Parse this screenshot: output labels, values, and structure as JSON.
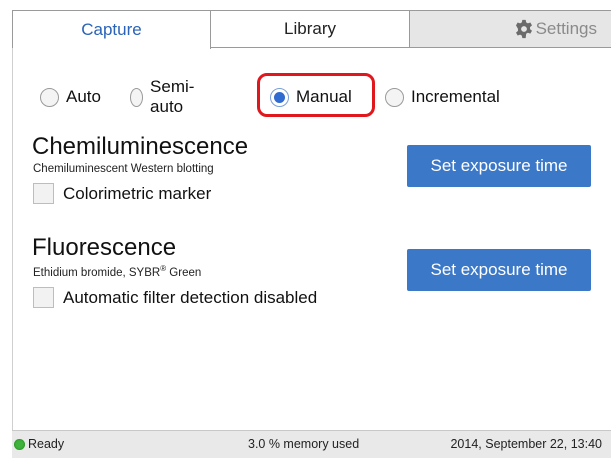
{
  "tabs": {
    "capture": "Capture",
    "library": "Library",
    "settings": "Settings"
  },
  "mode": {
    "options": [
      "Auto",
      "Semi-auto",
      "Manual",
      "Incremental"
    ],
    "selected": "Manual"
  },
  "chemi": {
    "title": "Chemiluminescence",
    "subtitle": "Chemiluminescent Western blotting",
    "checkbox_label": "Colorimetric marker",
    "button": "Set exposure time"
  },
  "fluor": {
    "title": "Fluorescence",
    "subtitle_pre": "Ethidium bromide, SYBR",
    "subtitle_reg": "®",
    "subtitle_post": " Green",
    "checkbox_label": "Automatic filter detection disabled",
    "button": "Set exposure time"
  },
  "status": {
    "ready": "Ready",
    "memory": "3.0 % memory used",
    "datetime": "2014, September 22, 13:40"
  },
  "colors": {
    "accent": "#3b78c8",
    "highlight": "#e0171d",
    "ready_led": "#3fb33b"
  },
  "icons": {
    "settings": "gear-icon",
    "ready": "status-led-icon"
  }
}
